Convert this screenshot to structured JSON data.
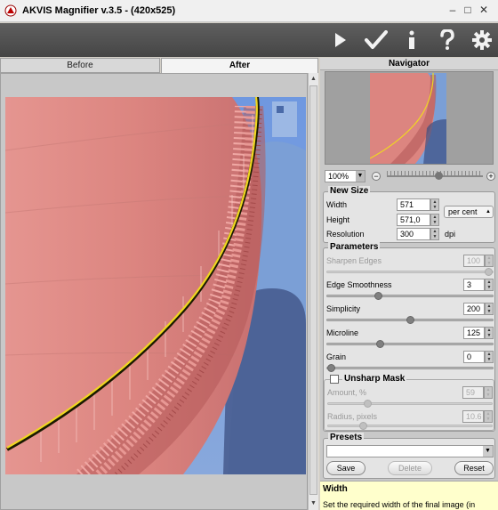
{
  "window": {
    "title": "AKVIS Magnifier v.3.5 - (420x525)",
    "controls": [
      "minimize-icon",
      "maximize-icon",
      "close-icon"
    ]
  },
  "toolbar": {
    "icons": [
      "run-icon",
      "apply-checkmark-icon",
      "info-icon",
      "help-icon",
      "settings-gear-icon"
    ]
  },
  "tabs": {
    "before": "Before",
    "after": "After",
    "active": "After"
  },
  "navigator": {
    "title": "Navigator",
    "zoom": "100%",
    "zoom_out": "−",
    "zoom_in": "+",
    "zoom_level": 0.55
  },
  "new_size": {
    "title": "New Size",
    "width_label": "Width",
    "width_value": "571",
    "height_label": "Height",
    "height_value": "571,0",
    "unit": "per cent",
    "resolution_label": "Resolution",
    "resolution_value": "300",
    "resolution_unit": "dpi"
  },
  "parameters": {
    "title": "Parameters",
    "sharpen_edges": {
      "label": "Sharpen Edges",
      "value": "100",
      "enabled": false,
      "level": 1.0
    },
    "edge_smoothness": {
      "label": "Edge Smoothness",
      "value": "3",
      "level": 0.3
    },
    "simplicity": {
      "label": "Simplicity",
      "value": "200",
      "level": 0.5
    },
    "microline": {
      "label": "Microline",
      "value": "125",
      "level": 0.31
    },
    "grain": {
      "label": "Grain",
      "value": "0",
      "level": 0.0
    }
  },
  "unsharp_mask": {
    "title": "Unsharp Mask",
    "checked": false,
    "amount": {
      "label": "Amount, %",
      "value": "59",
      "level": 0.23
    },
    "radius": {
      "label": "Radius, pixels",
      "value": "10.6",
      "level": 0.2
    }
  },
  "presets": {
    "title": "Presets",
    "selected": "",
    "save": "Save",
    "delete": "Delete",
    "reset": "Reset"
  },
  "help": {
    "title": "Width",
    "text": "Set the required width of the final image (in"
  },
  "colors": {
    "toolbar_bg": "#4e4e4e",
    "help_bg": "#ffffcc",
    "tank_pink": "#d98080",
    "sky_blue": "#7da0d8",
    "rail_yellow": "#e8d020"
  }
}
